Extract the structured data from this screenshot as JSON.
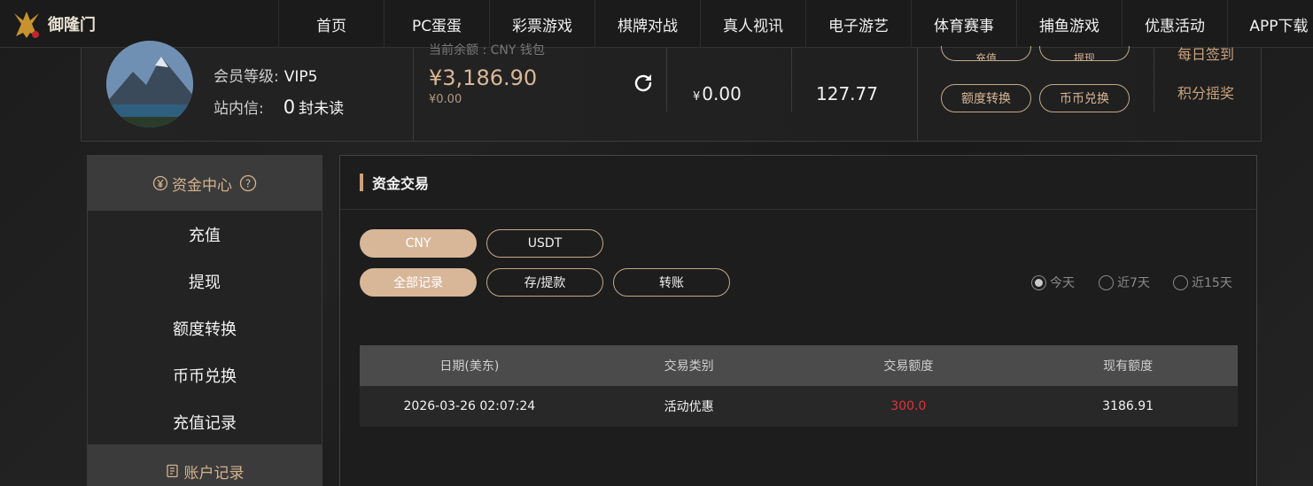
{
  "nav": {
    "logo_text": "御隆门",
    "items": [
      "首页",
      "PC蛋蛋",
      "彩票游戏",
      "棋牌对战",
      "真人视讯",
      "电子游艺",
      "体育赛事",
      "捕鱼游戏",
      "优惠活动",
      "APP下载"
    ]
  },
  "account": {
    "level_label": "会员等级:",
    "level_value": "VIP5",
    "msg_label": "站内信:",
    "msg_count": "0",
    "msg_unit": "封未读",
    "balance_head": "当前余额 : CNY 钱包",
    "balance": "¥3,186.90",
    "balance_sub": "¥0.00",
    "value1_prefix": "¥",
    "value1": "0.00",
    "value2": "127.77",
    "btn_deposit": "充值",
    "btn_withdraw": "提现",
    "btn_transfer": "额度转换",
    "btn_exchange": "币币兑换",
    "link_checkin": "每日签到",
    "link_points": "积分摇奖"
  },
  "sidebar": {
    "section1": "资金中心",
    "items": [
      "充值",
      "提现",
      "额度转换",
      "币币兑换",
      "充值记录"
    ],
    "section2": "账户记录"
  },
  "panel": {
    "title": "资金交易",
    "currency_tabs": [
      "CNY",
      "USDT"
    ],
    "record_tabs": [
      "全部记录",
      "存/提款",
      "转账"
    ],
    "ranges": [
      "今天",
      "近7天",
      "近15天"
    ],
    "columns": [
      "日期(美东)",
      "交易类别",
      "交易额度",
      "现有额度"
    ],
    "rows": [
      {
        "date": "2026-03-26 02:07:24",
        "type": "活动优惠",
        "amount": "300.0",
        "balance": "3186.91"
      }
    ]
  },
  "colors": {
    "accent": "#c9a27c",
    "active_tab": "#d8b799",
    "negative": "#e0333a"
  }
}
